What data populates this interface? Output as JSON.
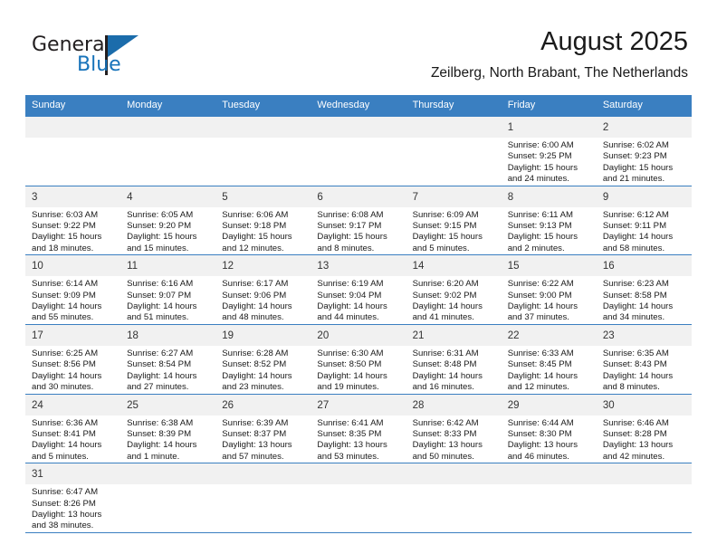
{
  "brand": {
    "name_top": "General",
    "name_bottom": "Blue",
    "flag_icon": "triangle-flag-icon",
    "colors": {
      "blue": "#1773ba",
      "dark": "#231f20"
    }
  },
  "header": {
    "title": "August 2025",
    "subtitle": "Zeilberg, North Brabant, The Netherlands"
  },
  "theme": {
    "header_blue": "#3a7fc1",
    "row_line_blue": "#3a7fc1",
    "daynum_band": "#f1f1f1"
  },
  "weekday_headers": [
    "Sunday",
    "Monday",
    "Tuesday",
    "Wednesday",
    "Thursday",
    "Friday",
    "Saturday"
  ],
  "labels": {
    "sunrise_prefix": "Sunrise:",
    "sunset_prefix": "Sunset:",
    "daylight_prefix": "Daylight:"
  },
  "weeks": [
    [
      {
        "day": "",
        "sunrise": "",
        "sunset": "",
        "daylight_line1": "",
        "daylight_line2": ""
      },
      {
        "day": "",
        "sunrise": "",
        "sunset": "",
        "daylight_line1": "",
        "daylight_line2": ""
      },
      {
        "day": "",
        "sunrise": "",
        "sunset": "",
        "daylight_line1": "",
        "daylight_line2": ""
      },
      {
        "day": "",
        "sunrise": "",
        "sunset": "",
        "daylight_line1": "",
        "daylight_line2": ""
      },
      {
        "day": "",
        "sunrise": "",
        "sunset": "",
        "daylight_line1": "",
        "daylight_line2": ""
      },
      {
        "day": "1",
        "sunrise": "Sunrise: 6:00 AM",
        "sunset": "Sunset: 9:25 PM",
        "daylight_line1": "Daylight: 15 hours",
        "daylight_line2": "and 24 minutes."
      },
      {
        "day": "2",
        "sunrise": "Sunrise: 6:02 AM",
        "sunset": "Sunset: 9:23 PM",
        "daylight_line1": "Daylight: 15 hours",
        "daylight_line2": "and 21 minutes."
      }
    ],
    [
      {
        "day": "3",
        "sunrise": "Sunrise: 6:03 AM",
        "sunset": "Sunset: 9:22 PM",
        "daylight_line1": "Daylight: 15 hours",
        "daylight_line2": "and 18 minutes."
      },
      {
        "day": "4",
        "sunrise": "Sunrise: 6:05 AM",
        "sunset": "Sunset: 9:20 PM",
        "daylight_line1": "Daylight: 15 hours",
        "daylight_line2": "and 15 minutes."
      },
      {
        "day": "5",
        "sunrise": "Sunrise: 6:06 AM",
        "sunset": "Sunset: 9:18 PM",
        "daylight_line1": "Daylight: 15 hours",
        "daylight_line2": "and 12 minutes."
      },
      {
        "day": "6",
        "sunrise": "Sunrise: 6:08 AM",
        "sunset": "Sunset: 9:17 PM",
        "daylight_line1": "Daylight: 15 hours",
        "daylight_line2": "and 8 minutes."
      },
      {
        "day": "7",
        "sunrise": "Sunrise: 6:09 AM",
        "sunset": "Sunset: 9:15 PM",
        "daylight_line1": "Daylight: 15 hours",
        "daylight_line2": "and 5 minutes."
      },
      {
        "day": "8",
        "sunrise": "Sunrise: 6:11 AM",
        "sunset": "Sunset: 9:13 PM",
        "daylight_line1": "Daylight: 15 hours",
        "daylight_line2": "and 2 minutes."
      },
      {
        "day": "9",
        "sunrise": "Sunrise: 6:12 AM",
        "sunset": "Sunset: 9:11 PM",
        "daylight_line1": "Daylight: 14 hours",
        "daylight_line2": "and 58 minutes."
      }
    ],
    [
      {
        "day": "10",
        "sunrise": "Sunrise: 6:14 AM",
        "sunset": "Sunset: 9:09 PM",
        "daylight_line1": "Daylight: 14 hours",
        "daylight_line2": "and 55 minutes."
      },
      {
        "day": "11",
        "sunrise": "Sunrise: 6:16 AM",
        "sunset": "Sunset: 9:07 PM",
        "daylight_line1": "Daylight: 14 hours",
        "daylight_line2": "and 51 minutes."
      },
      {
        "day": "12",
        "sunrise": "Sunrise: 6:17 AM",
        "sunset": "Sunset: 9:06 PM",
        "daylight_line1": "Daylight: 14 hours",
        "daylight_line2": "and 48 minutes."
      },
      {
        "day": "13",
        "sunrise": "Sunrise: 6:19 AM",
        "sunset": "Sunset: 9:04 PM",
        "daylight_line1": "Daylight: 14 hours",
        "daylight_line2": "and 44 minutes."
      },
      {
        "day": "14",
        "sunrise": "Sunrise: 6:20 AM",
        "sunset": "Sunset: 9:02 PM",
        "daylight_line1": "Daylight: 14 hours",
        "daylight_line2": "and 41 minutes."
      },
      {
        "day": "15",
        "sunrise": "Sunrise: 6:22 AM",
        "sunset": "Sunset: 9:00 PM",
        "daylight_line1": "Daylight: 14 hours",
        "daylight_line2": "and 37 minutes."
      },
      {
        "day": "16",
        "sunrise": "Sunrise: 6:23 AM",
        "sunset": "Sunset: 8:58 PM",
        "daylight_line1": "Daylight: 14 hours",
        "daylight_line2": "and 34 minutes."
      }
    ],
    [
      {
        "day": "17",
        "sunrise": "Sunrise: 6:25 AM",
        "sunset": "Sunset: 8:56 PM",
        "daylight_line1": "Daylight: 14 hours",
        "daylight_line2": "and 30 minutes."
      },
      {
        "day": "18",
        "sunrise": "Sunrise: 6:27 AM",
        "sunset": "Sunset: 8:54 PM",
        "daylight_line1": "Daylight: 14 hours",
        "daylight_line2": "and 27 minutes."
      },
      {
        "day": "19",
        "sunrise": "Sunrise: 6:28 AM",
        "sunset": "Sunset: 8:52 PM",
        "daylight_line1": "Daylight: 14 hours",
        "daylight_line2": "and 23 minutes."
      },
      {
        "day": "20",
        "sunrise": "Sunrise: 6:30 AM",
        "sunset": "Sunset: 8:50 PM",
        "daylight_line1": "Daylight: 14 hours",
        "daylight_line2": "and 19 minutes."
      },
      {
        "day": "21",
        "sunrise": "Sunrise: 6:31 AM",
        "sunset": "Sunset: 8:48 PM",
        "daylight_line1": "Daylight: 14 hours",
        "daylight_line2": "and 16 minutes."
      },
      {
        "day": "22",
        "sunrise": "Sunrise: 6:33 AM",
        "sunset": "Sunset: 8:45 PM",
        "daylight_line1": "Daylight: 14 hours",
        "daylight_line2": "and 12 minutes."
      },
      {
        "day": "23",
        "sunrise": "Sunrise: 6:35 AM",
        "sunset": "Sunset: 8:43 PM",
        "daylight_line1": "Daylight: 14 hours",
        "daylight_line2": "and 8 minutes."
      }
    ],
    [
      {
        "day": "24",
        "sunrise": "Sunrise: 6:36 AM",
        "sunset": "Sunset: 8:41 PM",
        "daylight_line1": "Daylight: 14 hours",
        "daylight_line2": "and 5 minutes."
      },
      {
        "day": "25",
        "sunrise": "Sunrise: 6:38 AM",
        "sunset": "Sunset: 8:39 PM",
        "daylight_line1": "Daylight: 14 hours",
        "daylight_line2": "and 1 minute."
      },
      {
        "day": "26",
        "sunrise": "Sunrise: 6:39 AM",
        "sunset": "Sunset: 8:37 PM",
        "daylight_line1": "Daylight: 13 hours",
        "daylight_line2": "and 57 minutes."
      },
      {
        "day": "27",
        "sunrise": "Sunrise: 6:41 AM",
        "sunset": "Sunset: 8:35 PM",
        "daylight_line1": "Daylight: 13 hours",
        "daylight_line2": "and 53 minutes."
      },
      {
        "day": "28",
        "sunrise": "Sunrise: 6:42 AM",
        "sunset": "Sunset: 8:33 PM",
        "daylight_line1": "Daylight: 13 hours",
        "daylight_line2": "and 50 minutes."
      },
      {
        "day": "29",
        "sunrise": "Sunrise: 6:44 AM",
        "sunset": "Sunset: 8:30 PM",
        "daylight_line1": "Daylight: 13 hours",
        "daylight_line2": "and 46 minutes."
      },
      {
        "day": "30",
        "sunrise": "Sunrise: 6:46 AM",
        "sunset": "Sunset: 8:28 PM",
        "daylight_line1": "Daylight: 13 hours",
        "daylight_line2": "and 42 minutes."
      }
    ],
    [
      {
        "day": "31",
        "sunrise": "Sunrise: 6:47 AM",
        "sunset": "Sunset: 8:26 PM",
        "daylight_line1": "Daylight: 13 hours",
        "daylight_line2": "and 38 minutes."
      },
      {
        "day": "",
        "sunrise": "",
        "sunset": "",
        "daylight_line1": "",
        "daylight_line2": ""
      },
      {
        "day": "",
        "sunrise": "",
        "sunset": "",
        "daylight_line1": "",
        "daylight_line2": ""
      },
      {
        "day": "",
        "sunrise": "",
        "sunset": "",
        "daylight_line1": "",
        "daylight_line2": ""
      },
      {
        "day": "",
        "sunrise": "",
        "sunset": "",
        "daylight_line1": "",
        "daylight_line2": ""
      },
      {
        "day": "",
        "sunrise": "",
        "sunset": "",
        "daylight_line1": "",
        "daylight_line2": ""
      },
      {
        "day": "",
        "sunrise": "",
        "sunset": "",
        "daylight_line1": "",
        "daylight_line2": ""
      }
    ]
  ]
}
